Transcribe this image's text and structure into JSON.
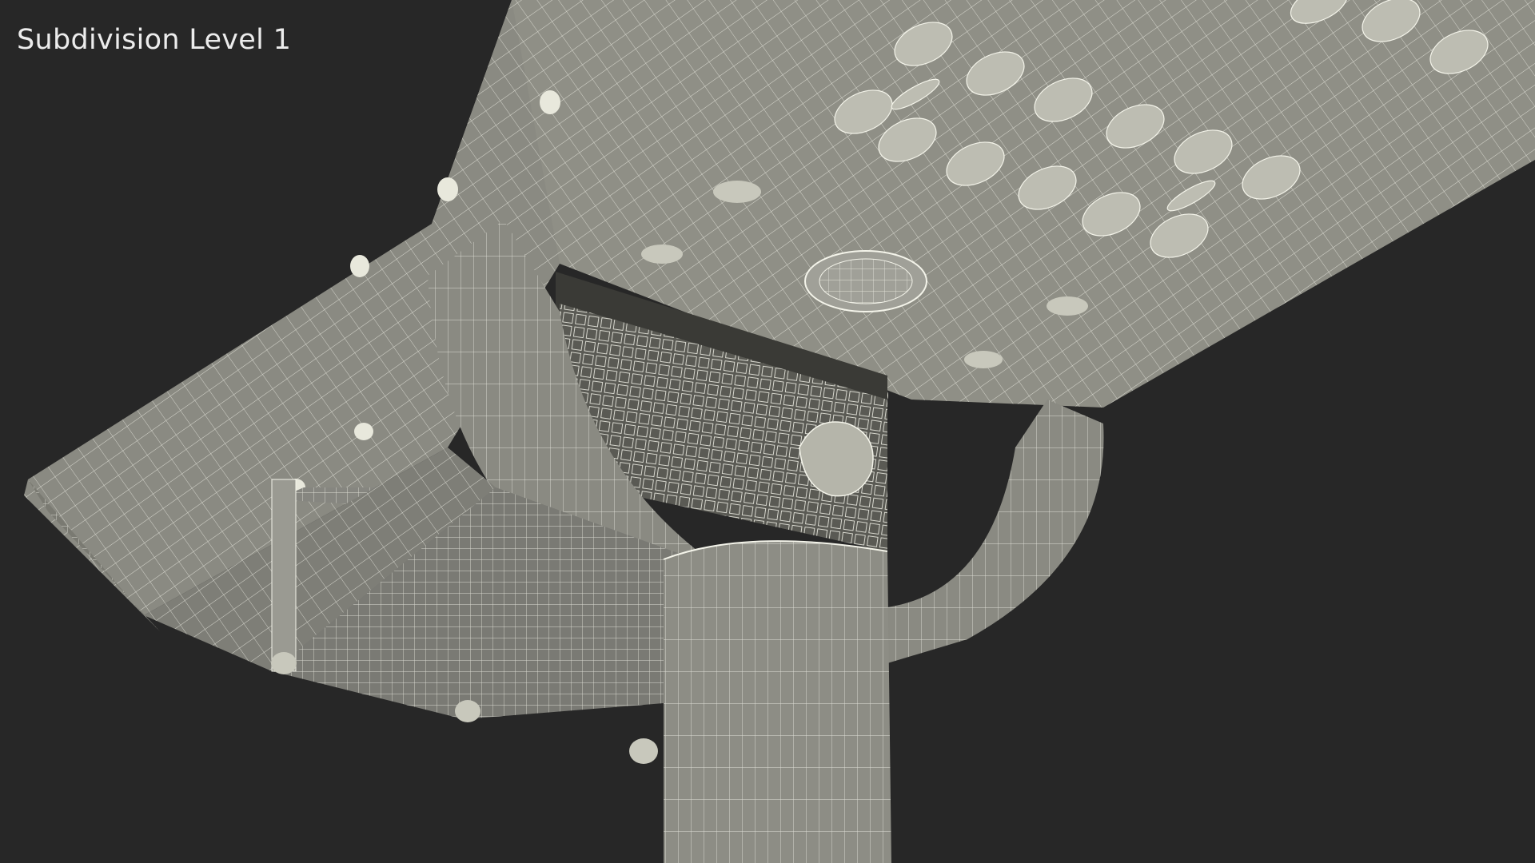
{
  "overlay": {
    "label": "Subdivision Level 1"
  },
  "colors": {
    "background": "#272727",
    "mesh_fill": "#8f8f86",
    "mesh_shadow": "#6e6e66",
    "mesh_dark": "#4e4e48",
    "wire": "#f4f4ea",
    "label": "#ececec"
  }
}
